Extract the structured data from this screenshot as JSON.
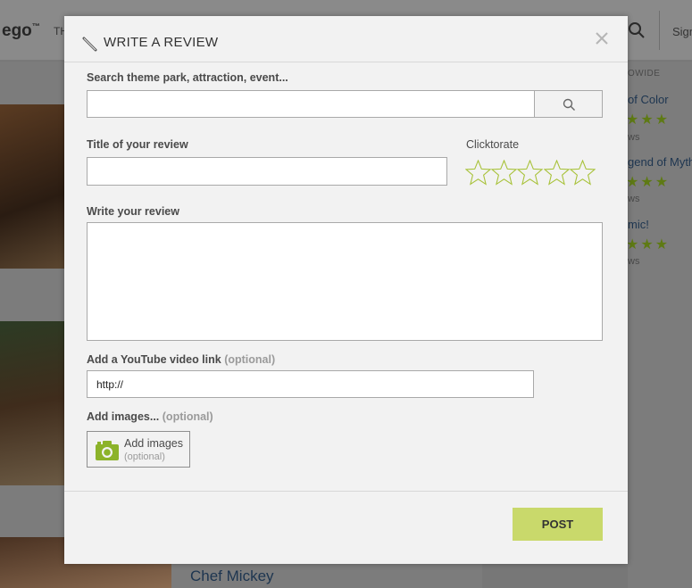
{
  "background": {
    "logo": "ego",
    "logo_mark": "™",
    "nav_text": "TH",
    "sign_text": "Sign",
    "side_heading": "OWIDE",
    "side_items": [
      {
        "title": "of Color",
        "stars": "★★★",
        "count": "ws"
      },
      {
        "title": "gend of Myth",
        "stars": "★★★",
        "count": "ws"
      },
      {
        "title": "mic!",
        "stars": "★★★",
        "count": "ws"
      }
    ],
    "chef_title": "Chef Mickey"
  },
  "modal": {
    "title": "WRITE A REVIEW",
    "search": {
      "label": "Search theme park, attraction, event...",
      "value": "",
      "placeholder": ""
    },
    "review_title": {
      "label": "Title of your review",
      "value": ""
    },
    "rating": {
      "label": "Clicktorate",
      "max": 5,
      "value": 0
    },
    "review_body": {
      "label": "Write your review",
      "value": ""
    },
    "youtube": {
      "label": "Add a YouTube video link",
      "optional": "(optional)",
      "value": "http://"
    },
    "images": {
      "label": "Add images...",
      "optional": "(optional)",
      "button_label": "Add images",
      "button_optional": "(optional)"
    },
    "post_label": "POST"
  },
  "colors": {
    "accent_green": "#c9d96b",
    "star_outline": "#a8c23a",
    "camera_green": "#8cb32a"
  }
}
